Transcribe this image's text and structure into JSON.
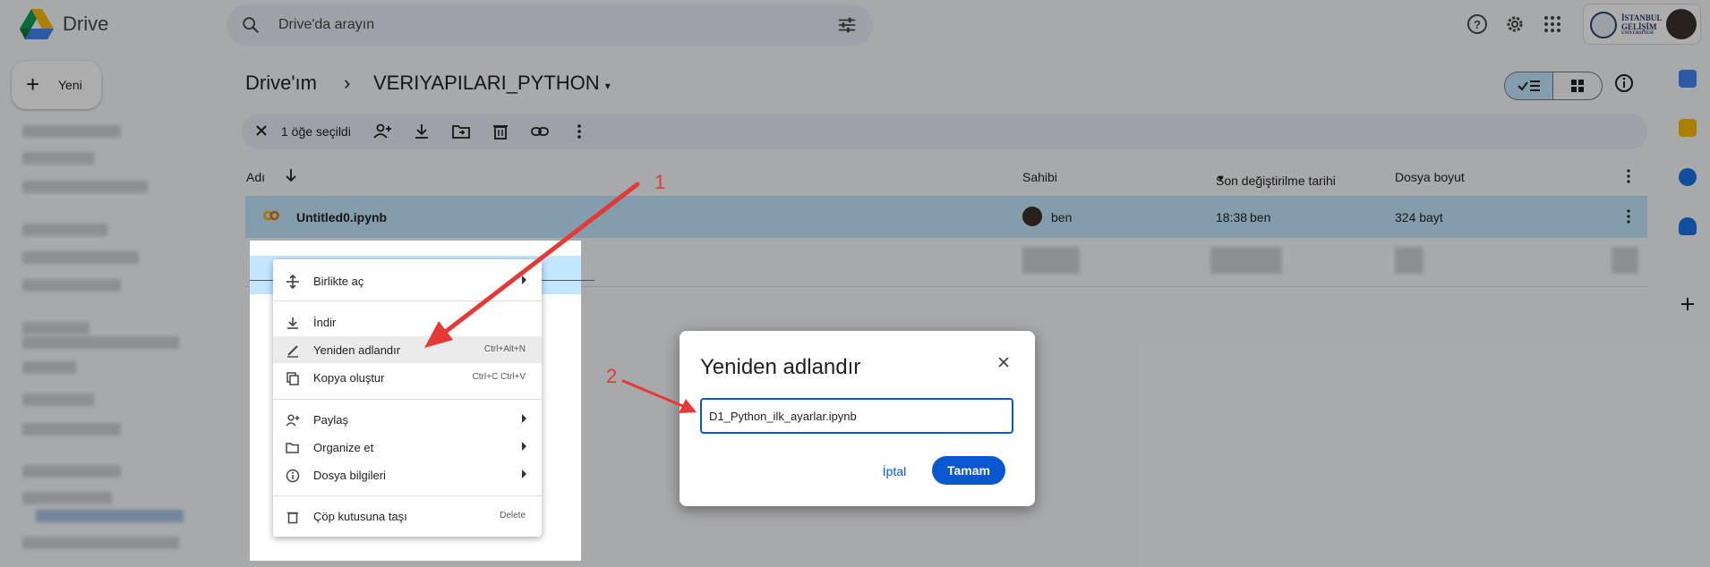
{
  "app": {
    "name": "Drive"
  },
  "search": {
    "placeholder": "Drive'da arayın"
  },
  "sidebar": {
    "new_label": "Yeni"
  },
  "breadcrumb": {
    "root": "Drive'ım",
    "separator": "›",
    "current": "VERIYAPILARI_PYTHON"
  },
  "account": {
    "org_line1": "İSTANBUL",
    "org_line2": "GELİŞİM",
    "org_line3": "ÜNİVERSİTESİ"
  },
  "selection_bar": {
    "count_label": "1 öğe seçildi"
  },
  "table": {
    "headers": {
      "name": "Adı",
      "owner": "Sahibi",
      "modified": "Son değiştirilme tarihi",
      "size": "Dosya boyut"
    },
    "selected_row": {
      "name": "Untitled0.ipynb",
      "owner": "ben",
      "modified_time": "18:38",
      "modified_by": "ben",
      "size": "324 bayt"
    }
  },
  "context_menu": {
    "items": [
      {
        "label": "Birlikte aç",
        "shortcut": "",
        "submenu": true
      },
      {
        "label": "İndir",
        "shortcut": "",
        "submenu": false
      },
      {
        "label": "Yeniden adlandır",
        "shortcut": "Ctrl+Alt+N",
        "submenu": false
      },
      {
        "label": "Kopya oluştur",
        "shortcut": "Ctrl+C Ctrl+V",
        "submenu": false
      },
      {
        "label": "Paylaş",
        "shortcut": "",
        "submenu": true
      },
      {
        "label": "Organize et",
        "shortcut": "",
        "submenu": true
      },
      {
        "label": "Dosya bilgileri",
        "shortcut": "",
        "submenu": true
      },
      {
        "label": "Çöp kutusuna taşı",
        "shortcut": "Delete",
        "submenu": false
      }
    ]
  },
  "dialog": {
    "title": "Yeniden adlandır",
    "input_value": "D1_Python_ilk_ayarlar.ipynb",
    "cancel_label": "İptal",
    "ok_label": "Tamam"
  },
  "annotations": {
    "step1": "1",
    "step2": "2"
  },
  "colors": {
    "accent": "#0b57d0",
    "selection": "#c2e7ff",
    "arrow": "#e53935"
  }
}
